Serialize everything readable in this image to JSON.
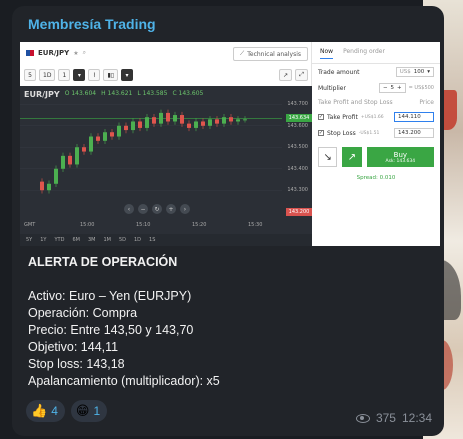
{
  "channel": {
    "name": "Membresía Trading"
  },
  "screenshot": {
    "symbol": "EUR/JPY",
    "technical_analysis_label": "Technical analysis",
    "toolbar": {
      "interval_a": "5",
      "interval_b": "1D",
      "interval_c": "1"
    },
    "chart_header": {
      "pair": "EUR/JPY",
      "open": "O 143.604",
      "high": "H 143.621",
      "low": "L 143.585",
      "close": "C 143.605"
    },
    "y_ticks": [
      "143.700",
      "143.600",
      "143.500",
      "143.400",
      "143.300"
    ],
    "price_current": "143.634",
    "price_stop": "143.200",
    "x_ticks": [
      "GMT",
      "15:00",
      "15:10",
      "15:20",
      "15:30"
    ],
    "timeframes": [
      "5Y",
      "1Y",
      "YTD",
      "6M",
      "3M",
      "1M",
      "5D",
      "1D",
      "1S"
    ],
    "candles": [
      {
        "o": 143.34,
        "c": 143.3
      },
      {
        "o": 143.3,
        "c": 143.33
      },
      {
        "o": 143.33,
        "c": 143.4
      },
      {
        "o": 143.4,
        "c": 143.46
      },
      {
        "o": 143.46,
        "c": 143.42
      },
      {
        "o": 143.42,
        "c": 143.5
      },
      {
        "o": 143.5,
        "c": 143.48
      },
      {
        "o": 143.48,
        "c": 143.55
      },
      {
        "o": 143.55,
        "c": 143.53
      },
      {
        "o": 143.53,
        "c": 143.57
      },
      {
        "o": 143.57,
        "c": 143.55
      },
      {
        "o": 143.55,
        "c": 143.6
      },
      {
        "o": 143.6,
        "c": 143.58
      },
      {
        "o": 143.58,
        "c": 143.62
      },
      {
        "o": 143.62,
        "c": 143.59
      },
      {
        "o": 143.59,
        "c": 143.64
      },
      {
        "o": 143.64,
        "c": 143.61
      },
      {
        "o": 143.61,
        "c": 143.66
      },
      {
        "o": 143.66,
        "c": 143.62
      },
      {
        "o": 143.62,
        "c": 143.65
      },
      {
        "o": 143.65,
        "c": 143.61
      },
      {
        "o": 143.61,
        "c": 143.59
      },
      {
        "o": 143.59,
        "c": 143.62
      },
      {
        "o": 143.62,
        "c": 143.6
      },
      {
        "o": 143.6,
        "c": 143.63
      },
      {
        "o": 143.63,
        "c": 143.61
      },
      {
        "o": 143.61,
        "c": 143.64
      },
      {
        "o": 143.64,
        "c": 143.62
      },
      {
        "o": 143.62,
        "c": 143.63
      },
      {
        "o": 143.63,
        "c": 143.63
      }
    ],
    "order": {
      "tab_now": "Now",
      "tab_pending": "Pending order",
      "trade_amount_label": "Trade amount",
      "trade_amount_currency": "US$",
      "trade_amount_value": "100",
      "multiplier_label": "Multiplier",
      "multiplier_value": "5",
      "multiplier_total": "= US$500",
      "tp_sl_label": "Take Profit and Stop Loss",
      "price_label": "Price",
      "take_profit_label": "Take Profit",
      "take_profit_hint": "+US$1.66",
      "take_profit_value": "144.110",
      "stop_loss_label": "Stop Loss",
      "stop_loss_hint": "-US$1.51",
      "stop_loss_value": "143.200",
      "buy_label": "Buy",
      "buy_ask": "Ask: 143.634",
      "spread": "Spread: 0.010"
    }
  },
  "message": {
    "title": "ALERTA DE OPERACIÓN",
    "lines": [
      "Activo: Euro – Yen (EURJPY)",
      "Operación: Compra",
      "Precio: Entre 143,50 y 143,70",
      "Objetivo: 144,11",
      "Stop loss: 143,18",
      "Apalancamiento (multiplicador): x5"
    ]
  },
  "reactions": [
    {
      "emoji": "👍",
      "count": "4"
    },
    {
      "emoji": "😁",
      "count": "1"
    }
  ],
  "meta": {
    "views": "375",
    "time": "12:34"
  },
  "colors": {
    "accent": "#4fb3e8",
    "bubble": "#212429",
    "buy_green": "#3aa644",
    "candle_up": "#4caf50",
    "candle_down": "#e0554d"
  }
}
